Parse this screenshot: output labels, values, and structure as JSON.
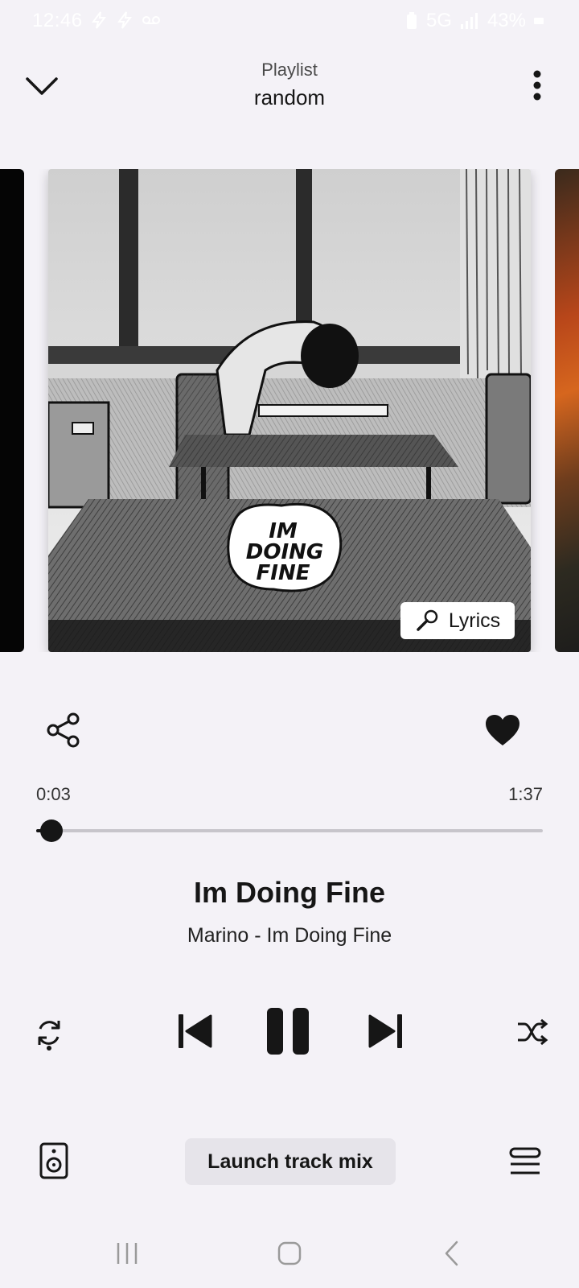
{
  "status_bar": {
    "time": "12:46",
    "network": "5G",
    "battery": "43%",
    "icons": [
      "flash-icon",
      "flash-icon",
      "voicemail-icon",
      "battery-icon",
      "signal-icon"
    ]
  },
  "header": {
    "caption": "Playlist",
    "playlist_name": "random",
    "collapse_icon": "chevron-down-icon",
    "menu_icon": "more-vert-icon"
  },
  "artwork": {
    "cover_text": [
      "IM",
      "DOING",
      "FINE"
    ],
    "lyrics_label": "Lyrics",
    "lyrics_icon": "microphone-icon"
  },
  "actions": {
    "share_icon": "share-icon",
    "like_icon": "heart-icon",
    "liked": true
  },
  "progress": {
    "elapsed": "0:03",
    "total": "1:37",
    "fraction": 0.03
  },
  "track": {
    "title": "Im Doing Fine",
    "subtitle": "Marino - Im Doing Fine"
  },
  "controls": {
    "repeat_icon": "repeat-icon",
    "previous_icon": "skip-previous-icon",
    "pause_icon": "pause-icon",
    "next_icon": "skip-next-icon",
    "shuffle_icon": "shuffle-icon"
  },
  "bottom": {
    "speaker_icon": "speaker-icon",
    "mix_label": "Launch track mix",
    "queue_icon": "queue-icon"
  },
  "colors": {
    "background": "#f4f2f7",
    "foreground": "#161616",
    "track": "#c7c5cb",
    "mix_button": "#e6e4ea"
  }
}
